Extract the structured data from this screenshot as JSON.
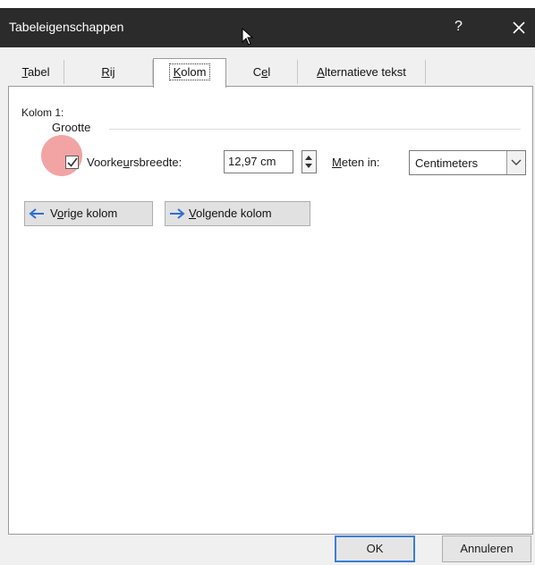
{
  "window": {
    "title": "Tabeleigenschappen",
    "help_label": "?"
  },
  "tabs": [
    {
      "label_pre": "",
      "label_u": "T",
      "label_post": "abel"
    },
    {
      "label_pre": "",
      "label_u": "R",
      "label_post": "ij"
    },
    {
      "label_pre": "",
      "label_u": "K",
      "label_post": "olom"
    },
    {
      "label_pre": "C",
      "label_u": "e",
      "label_post": "l"
    },
    {
      "label_pre": "",
      "label_u": "A",
      "label_post": "lternatieve tekst"
    }
  ],
  "active_tab": "Kolom",
  "column": {
    "heading": "Kolom 1:",
    "group_label": "Grootte",
    "preferred_width": {
      "checked": true,
      "label_pre": "Voorke",
      "label_u": "u",
      "label_post": "rsbreedte:",
      "value": "12,97 cm"
    },
    "measure_in": {
      "label_u": "M",
      "label_post": "eten in:",
      "selected": "Centimeters"
    }
  },
  "nav_buttons": {
    "prev": {
      "label_pre": "V",
      "label_u": "o",
      "label_post": "rige kolom"
    },
    "next": {
      "label_pre": "",
      "label_u": "V",
      "label_post": "olgende kolom"
    }
  },
  "footer": {
    "ok_label": "OK",
    "cancel_label": "Annuleren"
  },
  "colors": {
    "titlebar": "#2b2b2b",
    "dialog_bg": "#f0f0f0",
    "accent_blue": "#3b7fd9",
    "highlight": "#e85a5a"
  }
}
